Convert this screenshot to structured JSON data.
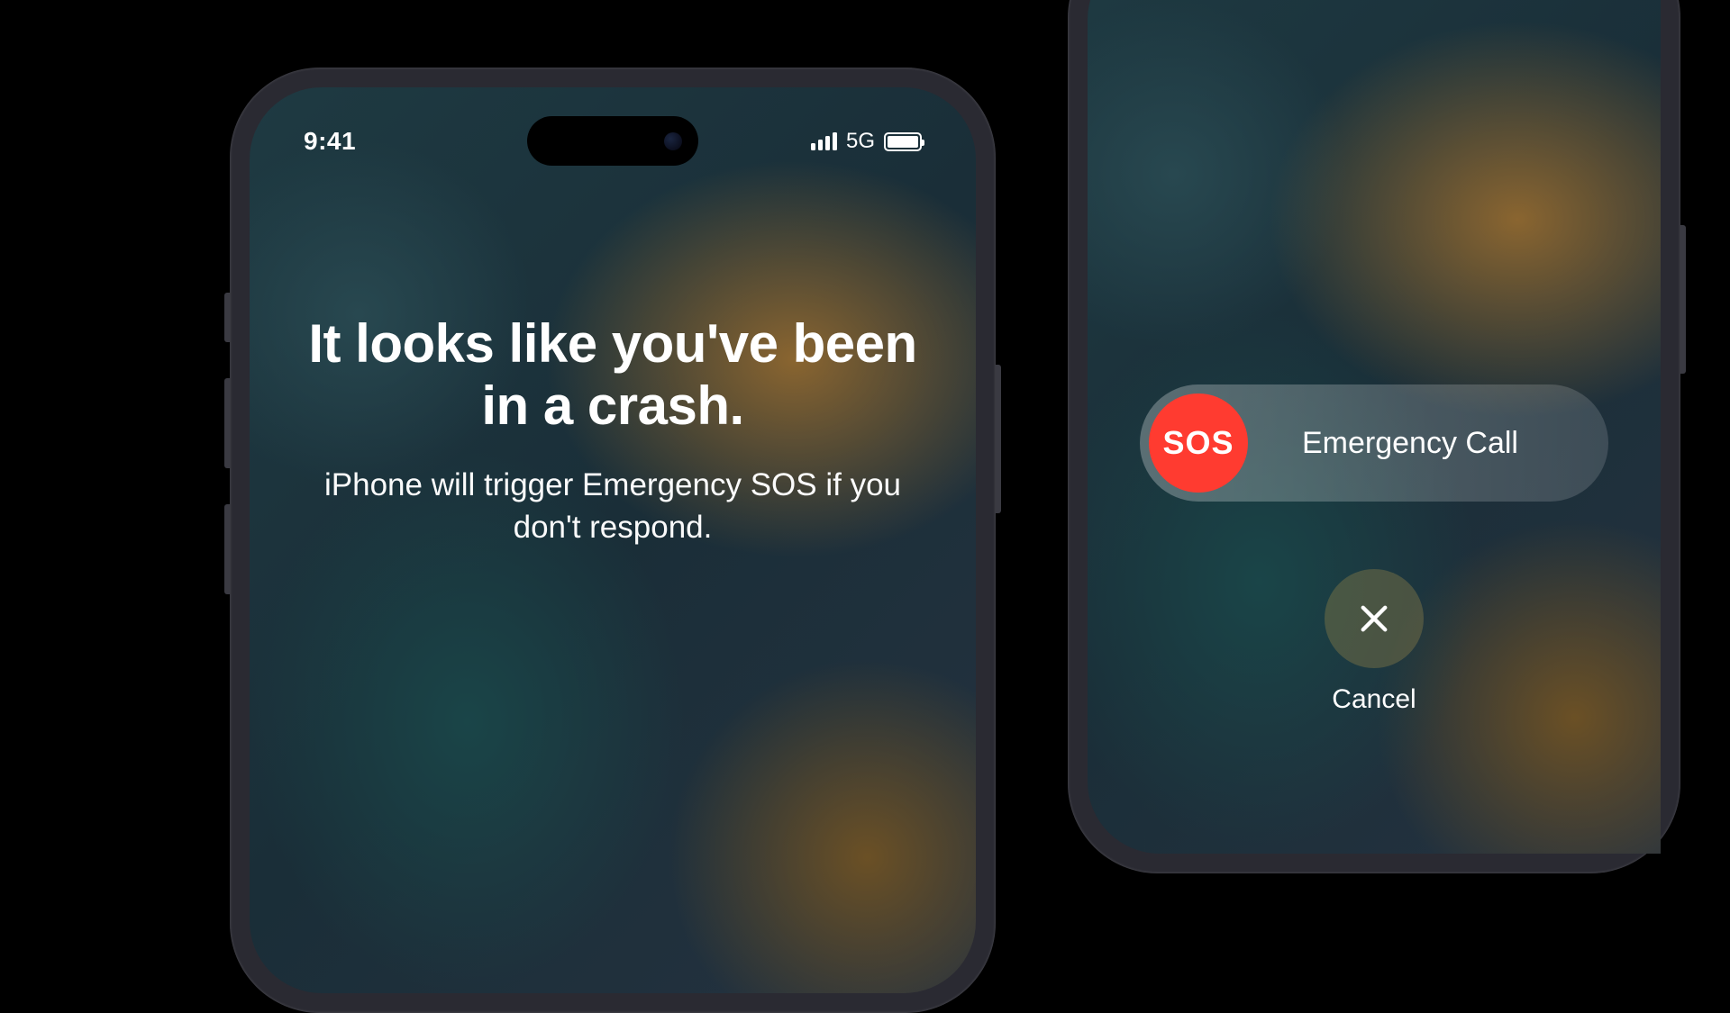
{
  "status_bar": {
    "time": "9:41",
    "network": "5G"
  },
  "crash_screen": {
    "headline": "It looks like you've been in a crash.",
    "subtext": "iPhone will trigger Emergency SOS if you don't respond."
  },
  "sos_screen": {
    "sos_badge": "SOS",
    "slider_label": "Emergency Call",
    "cancel_label": "Cancel"
  }
}
